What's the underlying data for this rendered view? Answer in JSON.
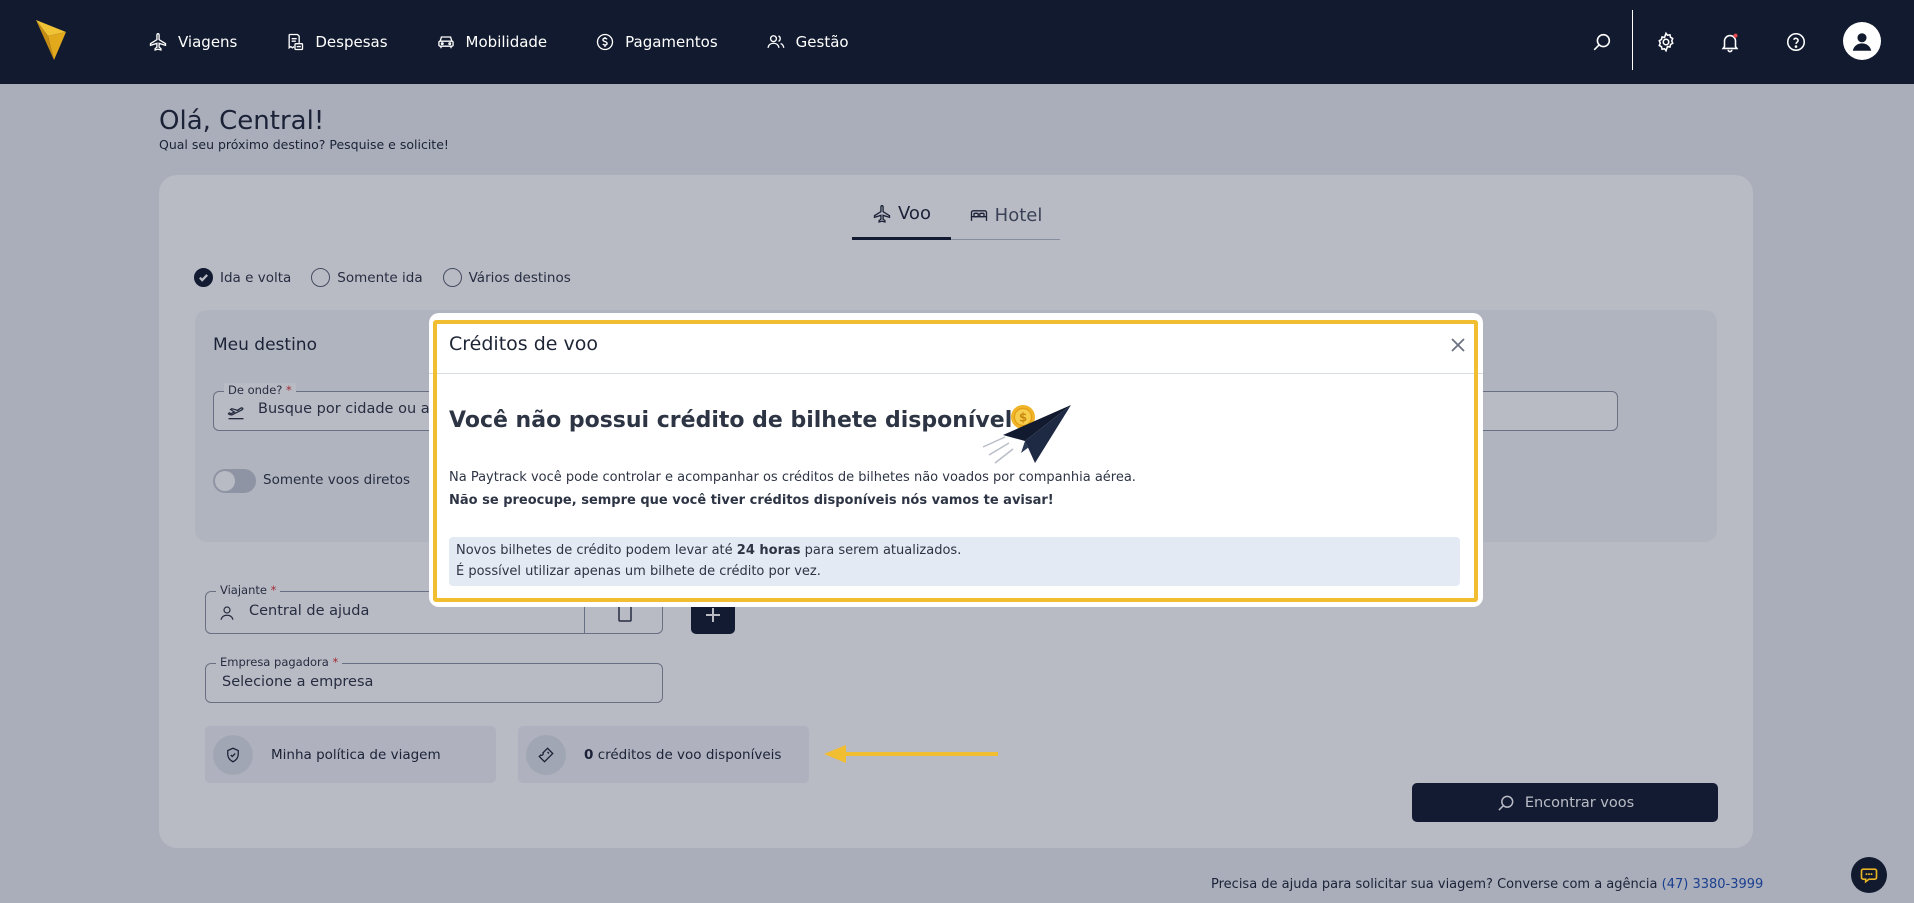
{
  "nav": {
    "items": [
      {
        "label": "Viagens",
        "icon": "plane-icon"
      },
      {
        "label": "Despesas",
        "icon": "receipt-icon"
      },
      {
        "label": "Mobilidade",
        "icon": "car-icon"
      },
      {
        "label": "Pagamentos",
        "icon": "dollar-circle-icon"
      },
      {
        "label": "Gestão",
        "icon": "users-icon"
      }
    ],
    "icons": [
      "search-icon",
      "gear-icon",
      "bell-icon",
      "help-icon",
      "avatar"
    ]
  },
  "greeting": {
    "title": "Olá, Central!",
    "subtitle": "Qual seu próximo destino? Pesquise e solicite!"
  },
  "tabs": {
    "voo": "Voo",
    "hotel": "Hotel",
    "active": "Voo"
  },
  "trip_types": {
    "round_trip": "Ida e volta",
    "one_way": "Somente ida",
    "multi": "Vários destinos",
    "selected": "Ida e volta"
  },
  "destination": {
    "title": "Meu destino",
    "origin_label": "De onde?",
    "origin_required": "*",
    "origin_placeholder": "Busque por cidade ou ae",
    "direct_only_label": "Somente voos diretos",
    "direct_only_on": false
  },
  "traveler": {
    "label": "Viajante",
    "required": "*",
    "value": "Central de ajuda"
  },
  "company": {
    "label": "Empresa pagadora",
    "required": "*",
    "placeholder": "Selecione a empresa"
  },
  "tiles": {
    "policy": "Minha política de viagem",
    "credits_count": "0",
    "credits_text": "créditos de voo disponíveis"
  },
  "find_button": "Encontrar voos",
  "footer": {
    "help_text": "Precisa de ajuda para solicitar sua viagem? Converse com a agência",
    "phone": "(47) 3380-3999"
  },
  "modal": {
    "title": "Créditos de voo",
    "heading": "Você não possui crédito de bilhete disponível",
    "text1": "Na Paytrack você pode controlar e acompanhar os créditos de bilhetes não voados por companhia aérea.",
    "text2": "Não se preocupe, sempre que você tiver créditos disponíveis nós vamos te avisar!",
    "notice_prefix": "Novos bilhetes de crédito podem levar até",
    "notice_bold": "24 horas",
    "notice_suffix": "para serem atualizados.",
    "notice_line2": "É possível utilizar apenas um bilhete de crédito por vez."
  },
  "colors": {
    "navy": "#111a2e",
    "highlight": "#f1bd31",
    "logo_yellow": "#e7b224",
    "link": "#1d4fb5"
  }
}
